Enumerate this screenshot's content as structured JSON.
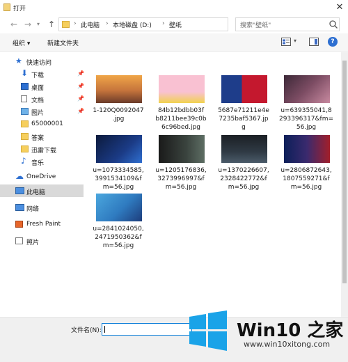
{
  "window": {
    "title": "打开"
  },
  "address": {
    "crumbs": [
      "此电脑",
      "本地磁盘 (D:)",
      "壁纸"
    ],
    "search_placeholder": "搜索\"壁纸\""
  },
  "toolbar": {
    "organize": "组织 ▾",
    "new_folder": "新建文件夹"
  },
  "sidebar": {
    "items": [
      {
        "label": "快速访问",
        "icon": "star-icon"
      },
      {
        "label": "下载",
        "icon": "download-icon",
        "pinned": true
      },
      {
        "label": "桌面",
        "icon": "desktop-icon",
        "pinned": true
      },
      {
        "label": "文档",
        "icon": "document-icon",
        "pinned": true
      },
      {
        "label": "图片",
        "icon": "picture-icon",
        "pinned": true
      },
      {
        "label": "65000001",
        "icon": "folder-icon"
      },
      {
        "label": "答案",
        "icon": "folder-icon"
      },
      {
        "label": "迅雷下载",
        "icon": "folder-icon"
      },
      {
        "label": "音乐",
        "icon": "music-icon"
      },
      {
        "label": "OneDrive",
        "icon": "cloud-icon"
      },
      {
        "label": "此电脑",
        "icon": "computer-icon"
      },
      {
        "label": "网络",
        "icon": "network-icon"
      },
      {
        "label": "Fresh Paint",
        "icon": "freshpaint-icon"
      },
      {
        "label": "照片",
        "icon": "photos-icon"
      }
    ]
  },
  "files": [
    {
      "name": "1-120Q0092047\n.jpg",
      "colors": [
        "#f0a648",
        "#6b3b2a"
      ]
    },
    {
      "name": "84b12bdbb03f\nb8211bee39c0b\n6c96bed.jpg",
      "colors": [
        "#f9c1d2",
        "#f1d24f"
      ]
    },
    {
      "name": "5687e71211e4e\n7235baf5367.jp\ng",
      "colors": [
        "#c4182e",
        "#1e3d8a"
      ]
    },
    {
      "name": "u=639355041,8\n293396317&fm=\n56.jpg",
      "colors": [
        "#3c2837",
        "#c88aa0"
      ]
    },
    {
      "name": "u=1073334585,\n3991534109&f\nm=56.jpg",
      "colors": [
        "#0c1a3c",
        "#2f6fd0"
      ]
    },
    {
      "name": "u=1205176836,\n3273996997&f\nm=56.jpg",
      "colors": [
        "#1a1a1a",
        "#5e6e64"
      ]
    },
    {
      "name": "u=1370226607,\n2328422772&f\nm=56.jpg",
      "colors": [
        "#1b1f24",
        "#4b5b6a"
      ]
    },
    {
      "name": "u=2806872643,\n1807559271&f\nm=56.jpg",
      "colors": [
        "#0c1f59",
        "#a21f2a"
      ]
    },
    {
      "name": "u=2841024050,\n2471950362&f\nm=56.jpg",
      "colors": [
        "#4ba7de",
        "#1d3d7c"
      ]
    }
  ],
  "bottom": {
    "filename_label": "文件名(N):",
    "filename_value": ""
  },
  "watermark": {
    "brand": "Win10 之家",
    "url": "www.win10xitong.com"
  }
}
